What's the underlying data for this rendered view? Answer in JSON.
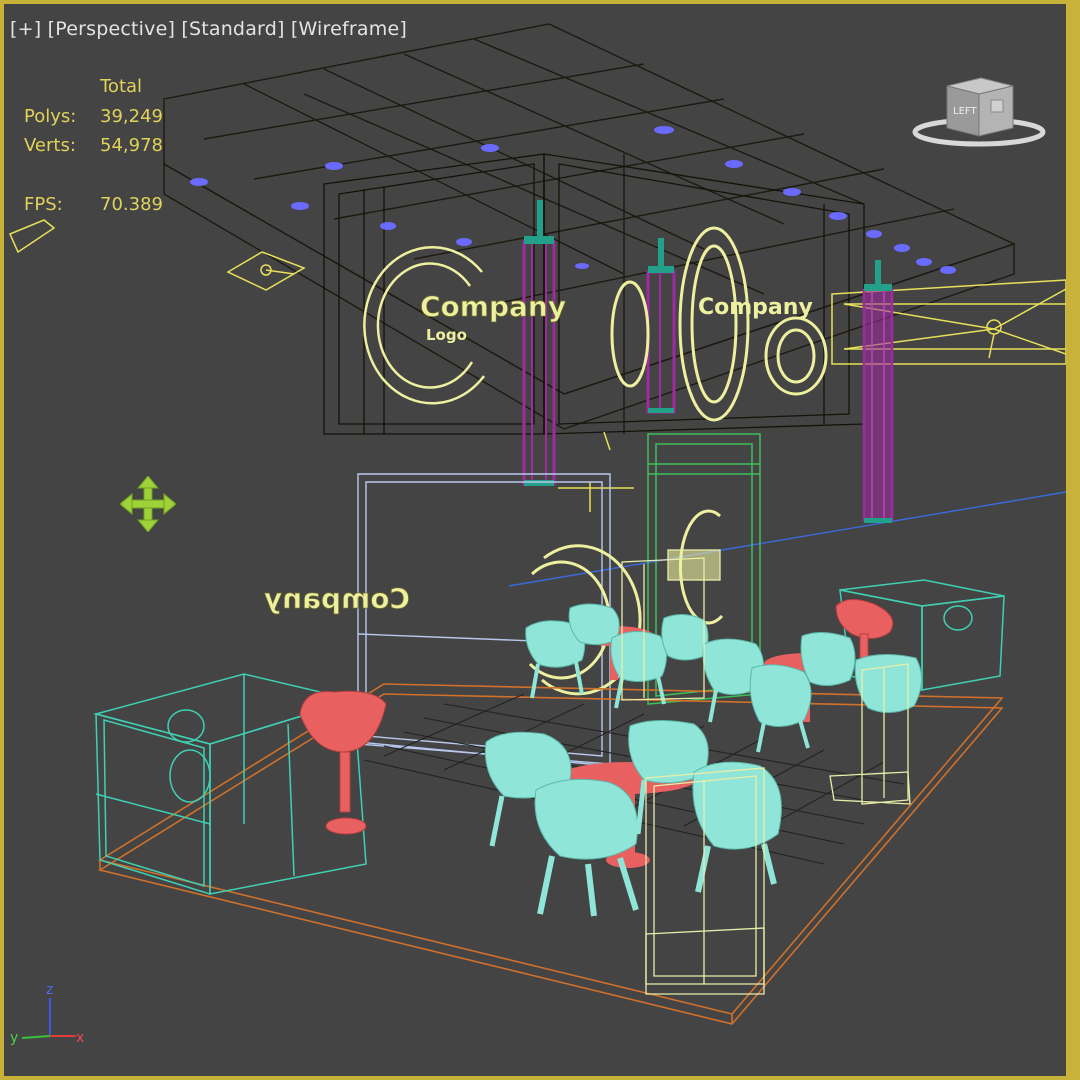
{
  "viewport": {
    "labels": [
      "[+]",
      "[Perspective]",
      "[Standard]",
      "[Wireframe]"
    ]
  },
  "stats": {
    "header": "Total",
    "polys_label": "Polys:",
    "polys_value": "39,249",
    "verts_label": "Verts:",
    "verts_value": "54,978",
    "fps_label": "FPS:",
    "fps_value": "70.389"
  },
  "viewcube": {
    "face_label": "LEFT"
  },
  "scene": {
    "logo_texts": {
      "company": "Company",
      "logo": "Logo"
    }
  },
  "axis": {
    "x": "x",
    "y": "y",
    "z": "z"
  },
  "colors": {
    "viewport_bg": "#444444",
    "frame": "#c9b23a",
    "ceiling_wire": "#1c1a10",
    "light_yellow": "#e8e05a",
    "column_magenta": "#a02aa0",
    "column_cap": "#22a08a",
    "chair_cyan": "#8fe6d8",
    "table_red": "#e86060",
    "cabinet_teal": "#3fd0b4",
    "floor_orange": "#d0702a",
    "logo_cream": "#eef0a0",
    "spot_blue": "#6a6aff"
  }
}
